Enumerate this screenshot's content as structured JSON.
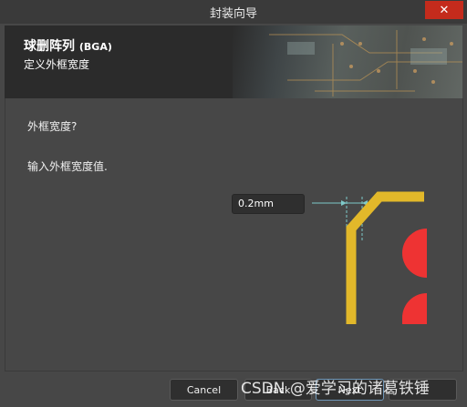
{
  "window": {
    "title": "封装向导",
    "close_label": "✕"
  },
  "header": {
    "title": "球删阵列",
    "title_suffix": "(BGA)",
    "subtitle": "定义外框宽度"
  },
  "content": {
    "question": "外框宽度?",
    "instruction": "输入外框宽度值.",
    "width_value": "0.2mm"
  },
  "buttons": {
    "cancel": "Cancel",
    "back": "Back",
    "next": "Next",
    "finish": ""
  },
  "watermark": "CSDN @爱学习的诸葛铁锤",
  "colors": {
    "outline": "#e2b82a",
    "pad": "#ee3333",
    "dimension_line": "#7ec8c8"
  }
}
